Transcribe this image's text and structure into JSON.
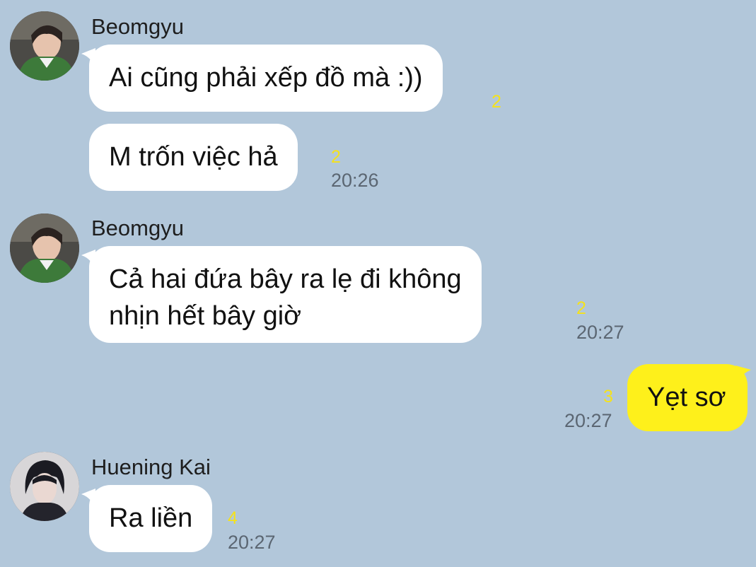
{
  "messages": [
    {
      "sender": "Beomgyu",
      "avatar_icon": "profile-photo-beomgyu",
      "bubbles": [
        {
          "text": "Ai cũng phải xếp đồ mà :))",
          "unread": "2"
        },
        {
          "text": "M trốn việc hả",
          "unread": "2",
          "time": "20:26"
        }
      ]
    },
    {
      "sender": "Beomgyu",
      "avatar_icon": "profile-photo-beomgyu",
      "bubbles": [
        {
          "lines": [
            "Cả hai đứa bây ra lẹ đi không",
            "nhịn hết bây giờ"
          ],
          "unread": "2",
          "time": "20:27"
        }
      ]
    },
    {
      "sender": "me",
      "bubbles": [
        {
          "text": "Yẹt sơ",
          "unread": "3",
          "time": "20:27"
        }
      ]
    },
    {
      "sender": "Huening Kai",
      "avatar_icon": "profile-photo-huening-kai",
      "bubbles": [
        {
          "text": "Ra liền",
          "unread": "4",
          "time": "20:27"
        }
      ]
    }
  ],
  "colors": {
    "background": "#b2c7da",
    "incoming_bubble": "#ffffff",
    "outgoing_bubble": "#fef01b",
    "unread_count": "#f5e21b",
    "timestamp": "#5b6672"
  }
}
